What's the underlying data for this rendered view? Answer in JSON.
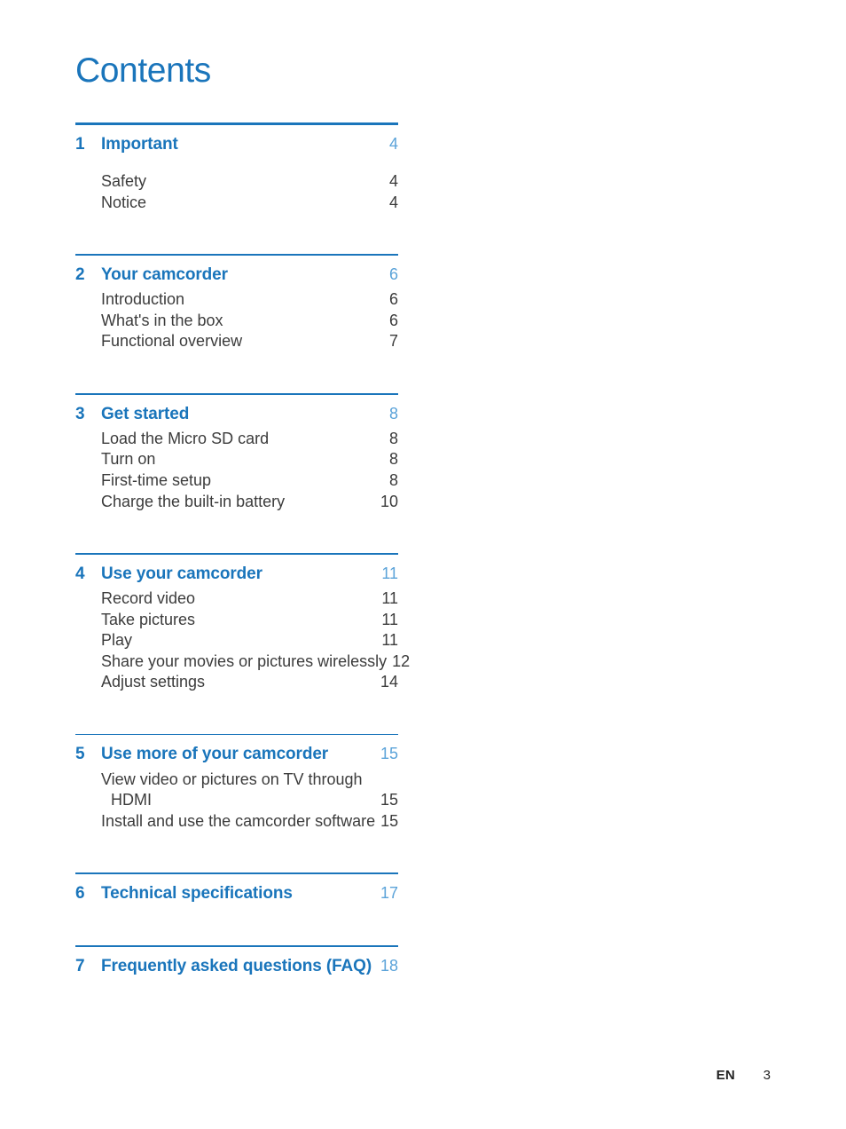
{
  "document": {
    "title": "Contents",
    "accent_color": "#1a75bb",
    "accent_light_color": "#5ba3d9",
    "body_text_color": "#3c3c3c"
  },
  "toc": {
    "sections": [
      {
        "number": "1",
        "title": "Important",
        "page": "4",
        "rule": "thick",
        "extra_gap": true,
        "items": [
          {
            "label": "Safety",
            "page": "4"
          },
          {
            "label": "Notice",
            "page": "4"
          }
        ]
      },
      {
        "number": "2",
        "title": "Your camcorder",
        "page": "6",
        "rule": "thin",
        "extra_gap": false,
        "items": [
          {
            "label": "Introduction",
            "page": "6"
          },
          {
            "label": "What's in the box",
            "page": "6"
          },
          {
            "label": "Functional overview",
            "page": "7"
          }
        ]
      },
      {
        "number": "3",
        "title": "Get started",
        "page": "8",
        "rule": "thin",
        "extra_gap": false,
        "items": [
          {
            "label": "Load the Micro SD card",
            "page": "8"
          },
          {
            "label": "Turn on",
            "page": "8"
          },
          {
            "label": "First-time setup",
            "page": "8"
          },
          {
            "label": "Charge the built-in battery",
            "page": "10"
          }
        ]
      },
      {
        "number": "4",
        "title": "Use your camcorder",
        "page": "11",
        "rule": "thin",
        "extra_gap": false,
        "items": [
          {
            "label": "Record video",
            "page": "11"
          },
          {
            "label": "Take pictures",
            "page": "11"
          },
          {
            "label": "Play",
            "page": "11"
          },
          {
            "label": "Share your movies or pictures wirelessly",
            "page": "12"
          },
          {
            "label": "Adjust settings",
            "page": "14"
          }
        ]
      },
      {
        "number": "5",
        "title": "Use more of your camcorder",
        "page": "15",
        "rule": "thin",
        "extra_gap": false,
        "items": [
          {
            "label": "View video or pictures on TV through",
            "page": "",
            "continued": true
          },
          {
            "label": "HDMI",
            "page": "15",
            "indent": true
          },
          {
            "label": "Install and use the camcorder software",
            "page": "15"
          }
        ]
      },
      {
        "number": "6",
        "title": "Technical specifications",
        "page": "17",
        "rule": "thin",
        "extra_gap": false,
        "items": []
      },
      {
        "number": "7",
        "title": "Frequently asked questions (FAQ)",
        "page": "18",
        "rule": "thin",
        "extra_gap": false,
        "items": []
      }
    ]
  },
  "footer": {
    "language": "EN",
    "page_number": "3"
  }
}
